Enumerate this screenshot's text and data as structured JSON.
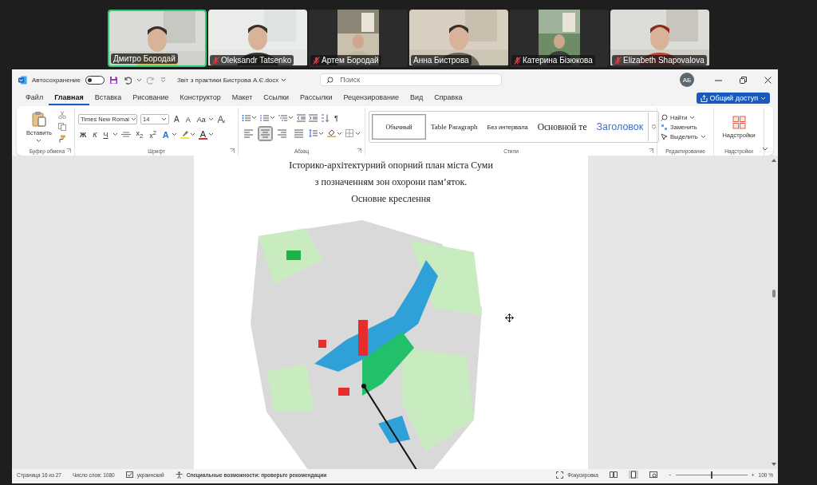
{
  "meeting": {
    "participants": [
      {
        "name": "Дмитро Бородай",
        "muted": false,
        "speaking": true,
        "kind": "landscape"
      },
      {
        "name": "Oleksandr Tatsenko",
        "muted": true,
        "speaking": false,
        "kind": "landscape"
      },
      {
        "name": "Артем Бородай",
        "muted": true,
        "speaking": false,
        "kind": "portrait"
      },
      {
        "name": "Анна Бистрова",
        "muted": false,
        "speaking": false,
        "kind": "landscape"
      },
      {
        "name": "Катерина Бізюкова",
        "muted": true,
        "speaking": false,
        "kind": "portrait"
      },
      {
        "name": "Elizabeth Shapovalova",
        "muted": true,
        "speaking": false,
        "kind": "landscape"
      }
    ]
  },
  "window": {
    "autosave_label": "Автосохранение",
    "autosave_on": false,
    "title": "Звіт з практики Бистрова А.Є.docx",
    "search": {
      "placeholder": "Поиск"
    },
    "user_initials": "АБ"
  },
  "menu_tabs": [
    {
      "label": "Файл",
      "selected": false
    },
    {
      "label": "Главная",
      "selected": true
    },
    {
      "label": "Вставка",
      "selected": false
    },
    {
      "label": "Рисование",
      "selected": false
    },
    {
      "label": "Конструктор",
      "selected": false
    },
    {
      "label": "Макет",
      "selected": false
    },
    {
      "label": "Ссылки",
      "selected": false
    },
    {
      "label": "Рассылки",
      "selected": false
    },
    {
      "label": "Рецензирование",
      "selected": false
    },
    {
      "label": "Вид",
      "selected": false
    },
    {
      "label": "Справка",
      "selected": false
    }
  ],
  "share_button": "Общий доступ",
  "ribbon": {
    "clipboard": {
      "paste": "Вставить",
      "group": "Буфер обмена"
    },
    "font": {
      "family": "Times New Romai",
      "size": "14",
      "grow": "A",
      "shrink": "A",
      "case": "Aa",
      "format_buttons": [
        "Ж",
        "К",
        "Ч"
      ],
      "script_buttons": [
        "x$_{2}$",
        "x$^{2}$"
      ],
      "effects": "A",
      "color_letter": "A",
      "group": "Шрифт"
    },
    "paragraph": {
      "pilcrow": "¶",
      "alignments": [
        {
          "selected": false
        },
        {
          "selected": true
        },
        {
          "selected": false
        },
        {
          "selected": false
        }
      ],
      "group": "Абзац"
    },
    "styles": {
      "items": [
        {
          "label": "Обычный",
          "selected": true
        },
        {
          "label": "Table Paragraph",
          "selected": false
        },
        {
          "label": "Без интервала",
          "selected": false
        },
        {
          "label": "Основной те",
          "selected": false
        },
        {
          "label": "Заголовок",
          "selected": false
        }
      ],
      "group": "Стили"
    },
    "editing": {
      "items": [
        "Найти",
        "Заменить",
        "Выделить"
      ],
      "group": "Редактирование"
    },
    "addins": {
      "button": "Надстройки",
      "group": "Надстройки"
    }
  },
  "document": {
    "lines": [
      "Історико-архітектурний опорний план міста Суми",
      "з позначенням зон охорони пам’яток.",
      "Основне креслення"
    ],
    "figure": {
      "kind": "picture"
    }
  },
  "status_bar": {
    "page": "Страница 16 из 27",
    "words": "Число слов: 1080",
    "language": "украинский",
    "accessibility": "Специальные возможности: проверьте рекомендации",
    "focus": "Фокусировка",
    "zoom": {
      "minus": "−",
      "plus": "+",
      "level": 0.5,
      "reading": "100 %"
    }
  }
}
